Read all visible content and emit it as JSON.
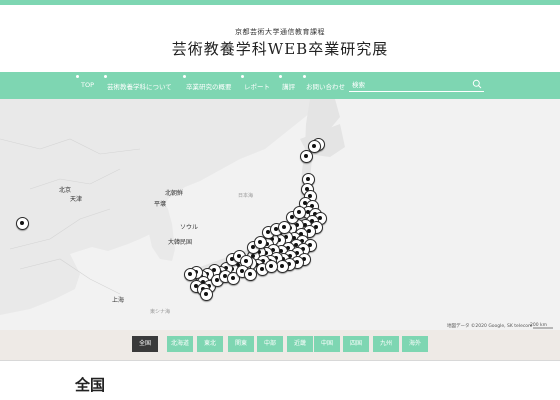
{
  "header": {
    "subtitle": "京都芸術大学通信教育課程",
    "title": "芸術教養学科WEB卒業研究展"
  },
  "nav": {
    "items": [
      {
        "id": "top",
        "label": "TOP"
      },
      {
        "id": "about",
        "label": "芸術教養学科について"
      },
      {
        "id": "overview",
        "label": "卒業研究の概要"
      },
      {
        "id": "report",
        "label": "レポート"
      },
      {
        "id": "review",
        "label": "講評"
      },
      {
        "id": "contact",
        "label": "お問い合わせ"
      }
    ],
    "search_placeholder": "検索"
  },
  "map": {
    "labels": [
      {
        "id": "beijing",
        "text": "北京"
      },
      {
        "id": "tianjin",
        "text": "天津"
      },
      {
        "id": "north-korea",
        "text": "北朝鮮"
      },
      {
        "id": "pyongyang",
        "text": "平壌"
      },
      {
        "id": "seoul",
        "text": "ソウル"
      },
      {
        "id": "south-korea",
        "text": "大韓民国"
      },
      {
        "id": "shanghai",
        "text": "上海"
      },
      {
        "id": "japan-sea",
        "text": "日本海"
      },
      {
        "id": "east-china-sea",
        "text": "東シナ海"
      }
    ],
    "attribution": "地図データ ©2020 Google, SK telecom",
    "scale": "200 km",
    "marker_count": 78
  },
  "regions": {
    "buttons": [
      "全国",
      "北海道",
      "東北",
      "関東",
      "中部",
      "近畿",
      "中国",
      "四国",
      "九州",
      "海外"
    ],
    "active": "全国"
  },
  "main": {
    "heading": "全国"
  },
  "colors": {
    "accent": "#7ed6b2",
    "active_button": "#3a3a3a",
    "map_land": "#e9e9e9",
    "map_sea": "#ffffff"
  }
}
